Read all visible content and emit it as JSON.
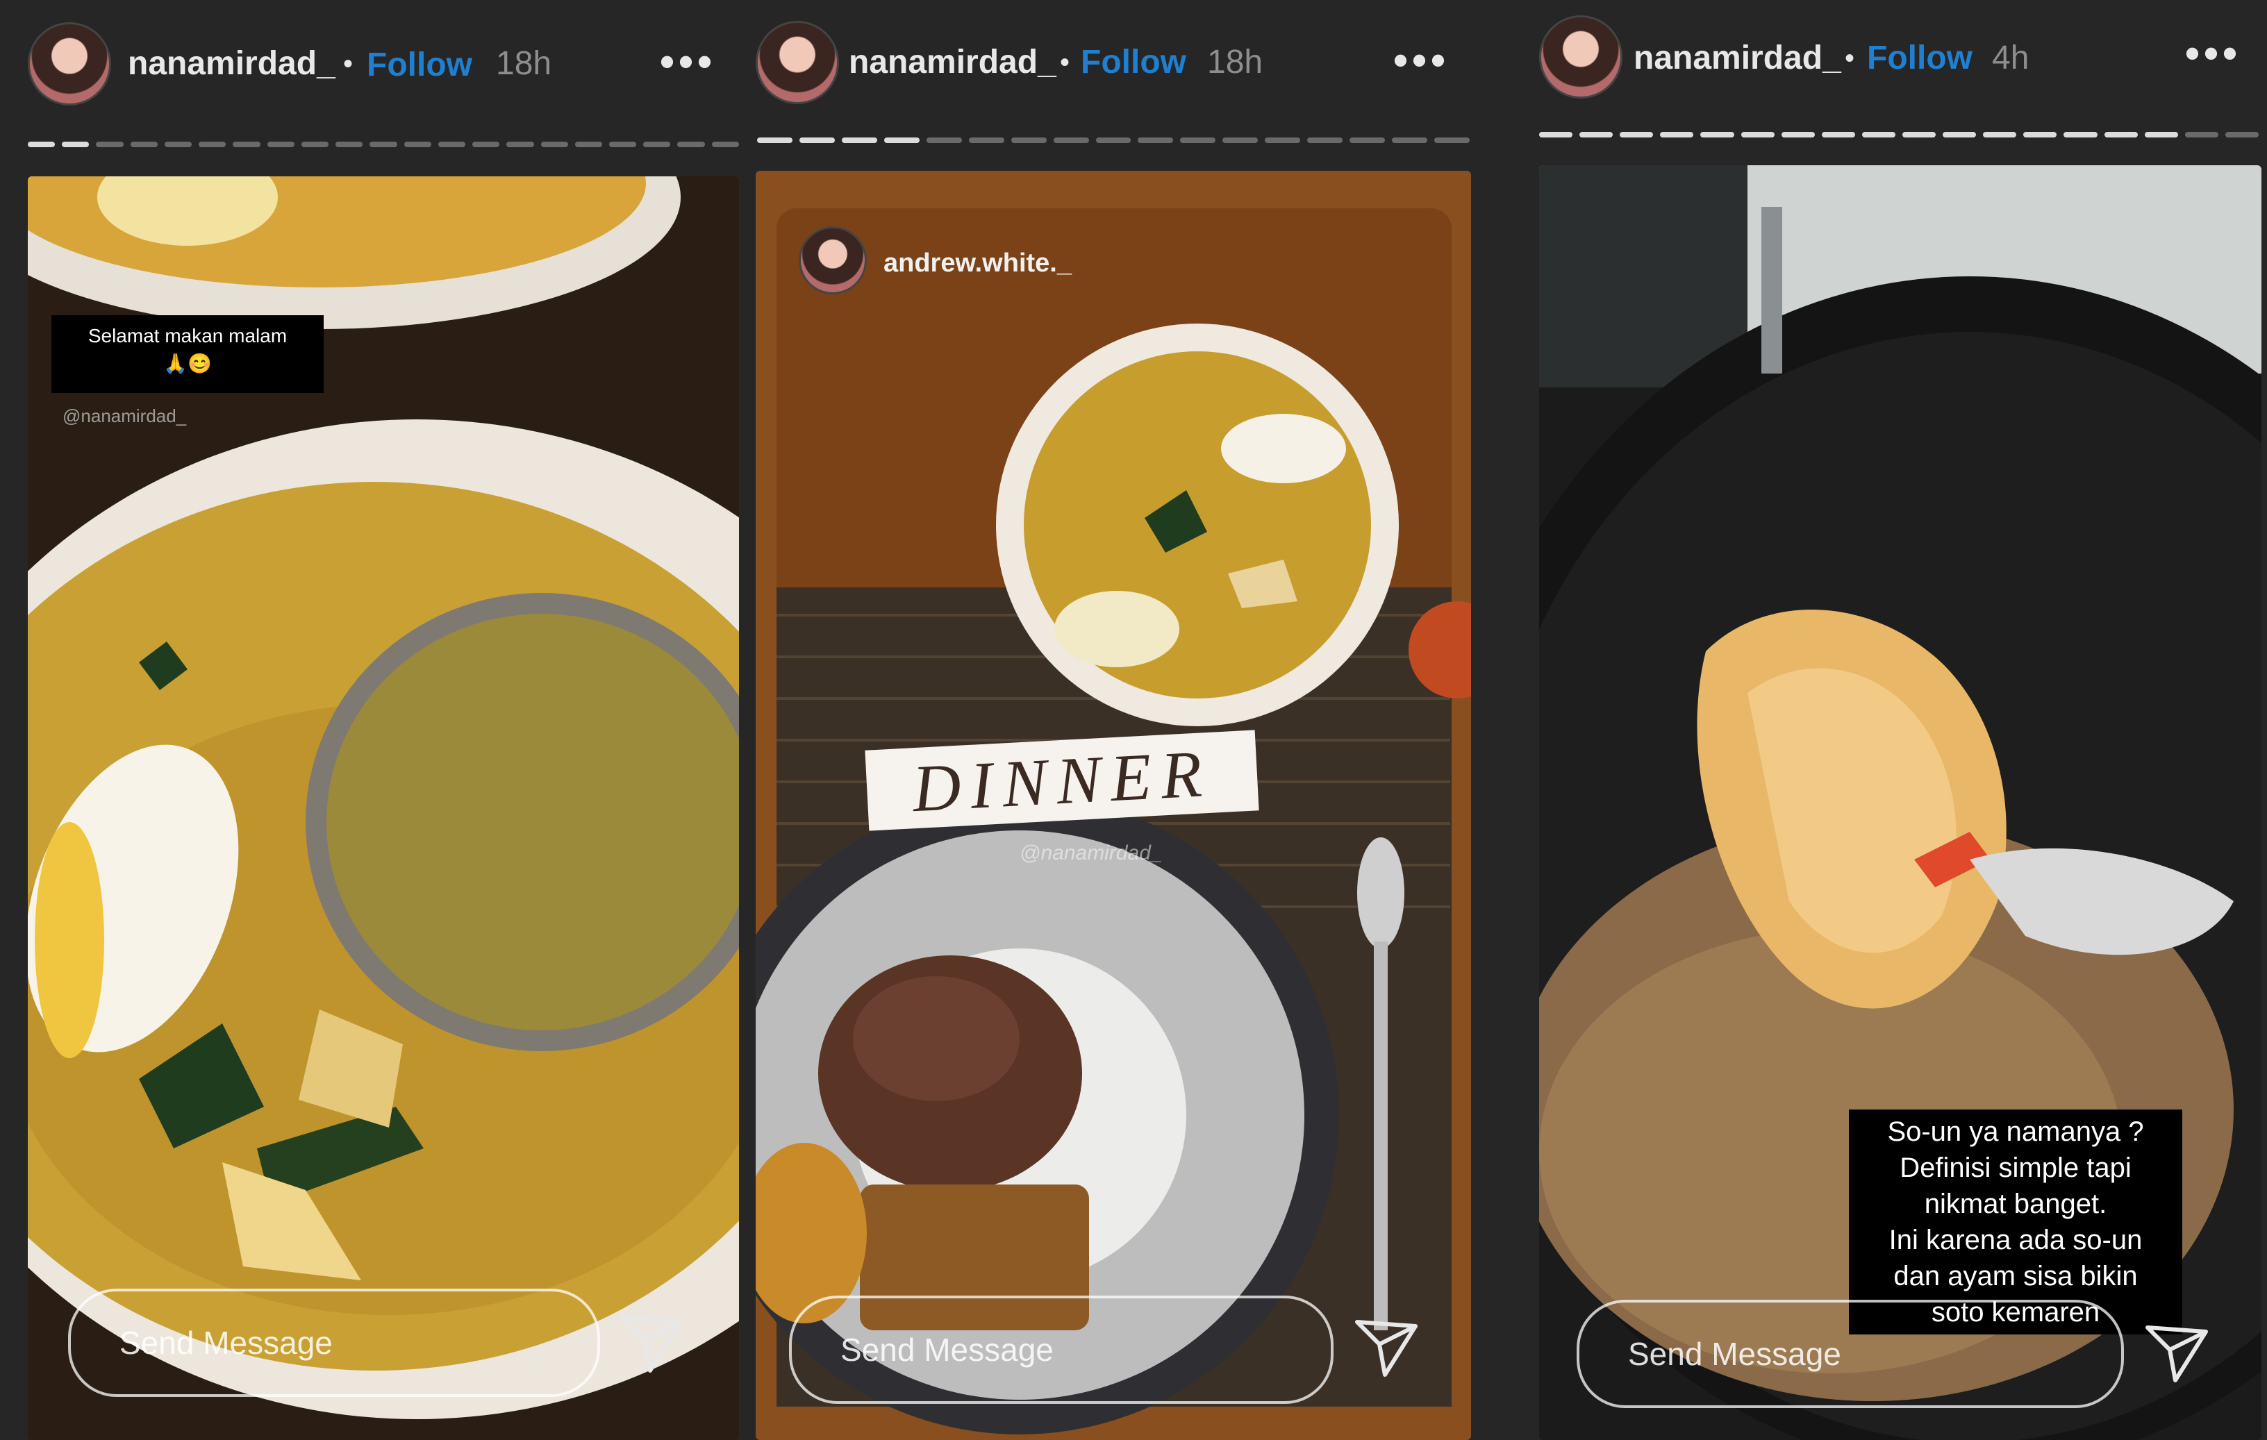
{
  "panels": [
    {
      "username": "nanamirdad_",
      "separator": "•",
      "follow_label": "Follow",
      "time": "18h",
      "more_label": "•••",
      "message_placeholder": "Send Message",
      "caption_line1": "Selamat makan malam",
      "caption_line2": "🙏😊",
      "mention": "@nanamirdad_"
    },
    {
      "username": "nanamirdad_",
      "separator": "•",
      "follow_label": "Follow",
      "time": "18h",
      "more_label": "•••",
      "message_placeholder": "Send Message",
      "shared_username": "andrew.white._",
      "sticker_text": "DINNER",
      "mention": "@nanamirdad_"
    },
    {
      "username": "nanamirdad_",
      "separator": "•",
      "follow_label": "Follow",
      "time": "4h",
      "more_label": "•••",
      "message_placeholder": "Send Message",
      "caption_lines": [
        "So-un ya namanya ?",
        "Definisi simple tapi",
        "nikmat banget.",
        "Ini karena ada so-un",
        "dan ayam sisa bikin",
        "soto kemaren"
      ]
    }
  ],
  "colors": {
    "background": "#262626",
    "follow": "#1f7fd1",
    "soup": "#c9a034",
    "wood": "#8a4f1f",
    "pan": "#1b1b1b"
  }
}
